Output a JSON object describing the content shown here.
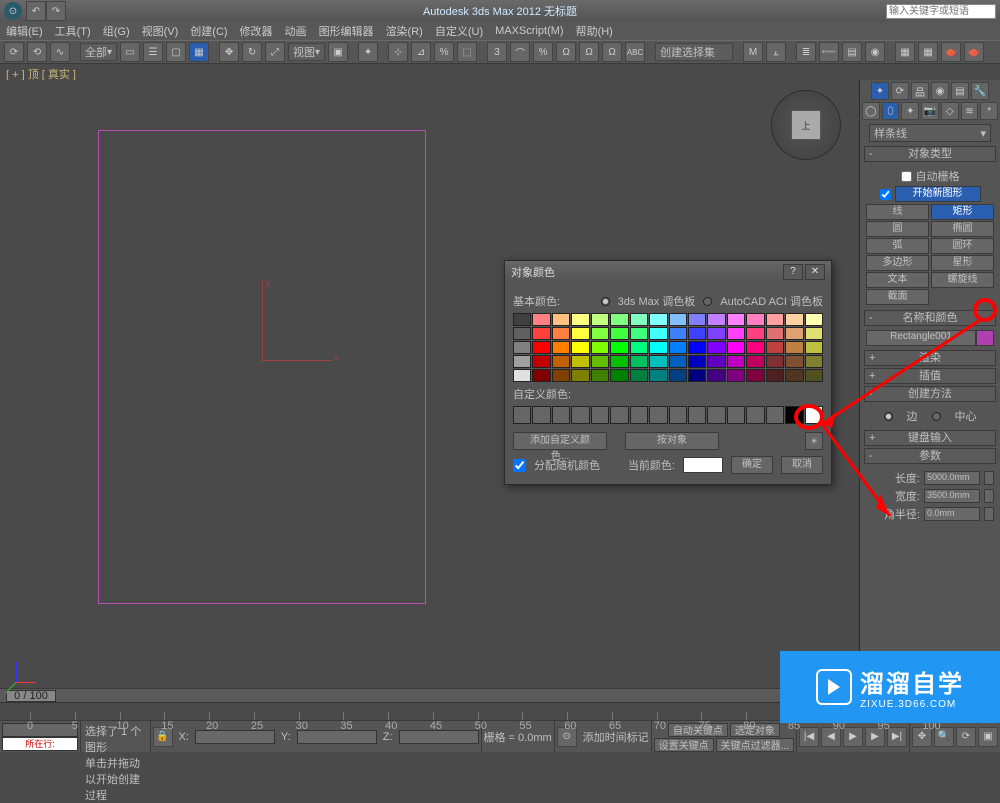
{
  "titlebar": {
    "title": "Autodesk 3ds Max 2012   无标题",
    "search_placeholder": "输入关键字或短语"
  },
  "menu": [
    "编辑(E)",
    "工具(T)",
    "组(G)",
    "视图(V)",
    "创建(C)",
    "修改器",
    "动画",
    "图形编辑器",
    "渲染(R)",
    "自定义(U)",
    "MAXScript(M)",
    "帮助(H)"
  ],
  "toolbar": {
    "scope": "全部",
    "view": "视图",
    "selset": "创建选择集"
  },
  "viewport": {
    "label": "[ + ] 顶 [ 真实 ]",
    "cube": "上"
  },
  "cmdpanel": {
    "dropdown": "样条线",
    "roll_objtype": "对象类型",
    "autogrid": "自动栅格",
    "startnew": "开始新图形",
    "btns": [
      [
        "线",
        "矩形"
      ],
      [
        "圆",
        "椭圆"
      ],
      [
        "弧",
        "圆环"
      ],
      [
        "多边形",
        "星形"
      ],
      [
        "文本",
        "螺旋线"
      ],
      [
        "截面",
        ""
      ]
    ],
    "roll_namecolor": "名称和颜色",
    "objname": "Rectangle001",
    "roll_render": "渲染",
    "roll_interp": "插值",
    "roll_method": "创建方法",
    "edge": "边",
    "center": "中心",
    "roll_kbd": "键盘输入",
    "roll_params": "参数",
    "length_l": "长度:",
    "length_v": "5000.0mm",
    "width_l": "宽度:",
    "width_v": "3500.0mm",
    "corner_l": "角半径:",
    "corner_v": "0.0mm"
  },
  "dialog": {
    "title": "对象颜色",
    "basic": "基本颜色:",
    "pal3ds": "3ds Max 调色板",
    "palaci": "AutoCAD ACI 调色板",
    "custom": "自定义颜色:",
    "addcustom": "添加自定义颜色...",
    "byobject": "按对象",
    "assignrandom": "分配随机颜色",
    "current": "当前颜色:",
    "ok": "确定",
    "cancel": "取消"
  },
  "timeline": {
    "range": "0 / 100"
  },
  "status": {
    "sel": "选择了 1 个 图形",
    "prompt": "单击并拖动以开始创建过程",
    "loc": "所在行:",
    "grid": "栅格 = 0.0mm",
    "addtime": "添加时间标记",
    "autokey": "自动关键点",
    "selkey": "选定对象",
    "setkey": "设置关键点",
    "keyfilter": "关键点过滤器..."
  },
  "watermark": {
    "big": "溜溜自学",
    "small": "ZIXUE.3D66.COM"
  },
  "palette_colors": [
    "#404040",
    "#ff8080",
    "#ffc080",
    "#ffff80",
    "#c0ff80",
    "#80ff80",
    "#80ffc0",
    "#80ffff",
    "#80c0ff",
    "#8080ff",
    "#c080ff",
    "#ff80ff",
    "#ff80c0",
    "#ffa0a0",
    "#ffd0a0",
    "#ffffb0",
    "#606060",
    "#ff4040",
    "#ff8040",
    "#ffff40",
    "#80ff40",
    "#40ff40",
    "#40ff80",
    "#40ffff",
    "#4080ff",
    "#4040ff",
    "#8040ff",
    "#ff40ff",
    "#ff4080",
    "#e07070",
    "#e0a070",
    "#e0e070",
    "#808080",
    "#ff0000",
    "#ff8000",
    "#ffff00",
    "#80ff00",
    "#00ff00",
    "#00ff80",
    "#00ffff",
    "#0080ff",
    "#0000ff",
    "#8000ff",
    "#ff00ff",
    "#ff0080",
    "#c04040",
    "#c08040",
    "#c0c040",
    "#a0a0a0",
    "#c00000",
    "#c06000",
    "#c0c000",
    "#60c000",
    "#00c000",
    "#00c060",
    "#00c0c0",
    "#0060c0",
    "#0000c0",
    "#6000c0",
    "#c000c0",
    "#c00060",
    "#803030",
    "#805030",
    "#808030",
    "#e0e0e0",
    "#800000",
    "#804000",
    "#808000",
    "#408000",
    "#008000",
    "#008040",
    "#008080",
    "#004080",
    "#000080",
    "#400080",
    "#800080",
    "#800040",
    "#502020",
    "#503520",
    "#505020"
  ]
}
